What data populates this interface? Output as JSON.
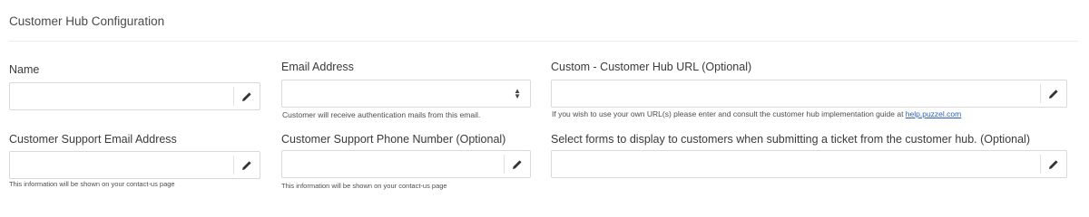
{
  "section": {
    "title": "Customer Hub Configuration"
  },
  "fields": {
    "name": {
      "label": "Name",
      "value": ""
    },
    "email_address": {
      "label": "Email Address",
      "value": "",
      "help": "Customer will receive authentication mails from this email."
    },
    "custom_url": {
      "label": "Custom - Customer Hub URL (Optional)",
      "value": "",
      "help_prefix": "If you wish to use your own URL(s) please enter and consult the customer hub implementation guide at ",
      "help_link": "help.puzzel.com"
    },
    "support_email": {
      "label": "Customer Support Email Address",
      "value": "",
      "help": "This information will be shown on your contact-us page"
    },
    "support_phone": {
      "label": "Customer Support Phone Number (Optional)",
      "value": "",
      "help": "This information will be shown on your contact-us page"
    },
    "forms": {
      "label": "Select forms to display to customers when submitting a ticket from the customer hub. (Optional)",
      "value": ""
    }
  },
  "icons": {
    "edit": "pencil-icon",
    "select": "sort-arrows-icon"
  }
}
